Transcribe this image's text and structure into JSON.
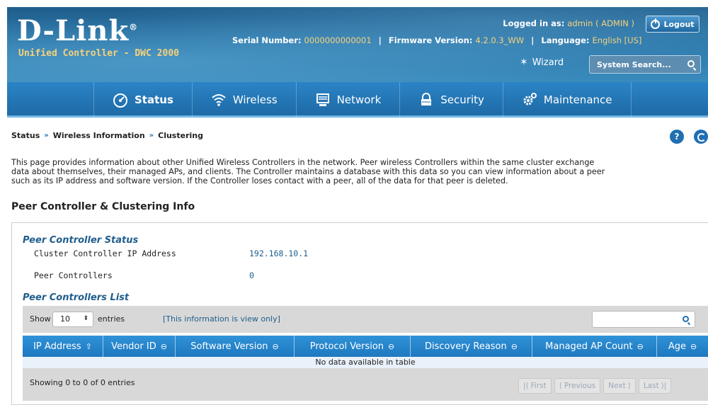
{
  "brand": {
    "logo": "D-Link",
    "logo_mark": "®",
    "product": "Unified Controller - DWC 2000"
  },
  "header": {
    "logged_in_label": "Logged in as:",
    "logged_in_value": "admin ( ADMIN )",
    "logout_label": "Logout",
    "serial_label": "Serial Number:",
    "serial_value": "0000000000001",
    "firmware_label": "Firmware Version:",
    "firmware_value": "4.2.0.3_WW",
    "language_label": "Language:",
    "language_value": "English [US]",
    "separator": "|",
    "wizard_label": "Wizard",
    "search_placeholder": "System Search..."
  },
  "nav": {
    "items": [
      {
        "label": "Status",
        "icon": "gauge-icon"
      },
      {
        "label": "Wireless",
        "icon": "wifi-icon"
      },
      {
        "label": "Network",
        "icon": "monitor-icon"
      },
      {
        "label": "Security",
        "icon": "lock-icon"
      },
      {
        "label": "Maintenance",
        "icon": "gears-icon"
      }
    ]
  },
  "breadcrumb": [
    "Status",
    "Wireless Information",
    "Clustering"
  ],
  "breadcrumb_sep": "»",
  "help_label": "?",
  "description": [
    "This page provides information about other Unified Wireless Controllers in the network. Peer wireless Controllers within the same cluster exchange",
    "data about themselves, their managed APs, and clients. The Controller maintains a database with this data so you can view information about a peer",
    "such as its IP address and software version. If the Controller loses contact with a peer, all of the data for that peer is deleted."
  ],
  "section_title": "Peer Controller & Clustering Info",
  "status": {
    "title": "Peer Controller Status",
    "cluster_ip_label": "Cluster Controller IP Address",
    "cluster_ip_value": "192.168.10.1",
    "peer_count_label": "Peer Controllers",
    "peer_count_value": "0"
  },
  "list": {
    "title": "Peer Controllers List",
    "show_label": "Show",
    "entries_value": "10",
    "entries_label": "entries",
    "view_only": "[This information is view only]",
    "columns": [
      "IP Address",
      "Vendor ID",
      "Software Version",
      "Protocol Version",
      "Discovery Reason",
      "Managed AP Count",
      "Age"
    ],
    "empty_message": "No data available in table",
    "showing": "Showing 0 to 0 of 0 entries",
    "pager": [
      "First",
      "Previous",
      "Next",
      "Last"
    ]
  },
  "colors": {
    "header": "#2a76a8",
    "nav": "#1e6aa6",
    "accent": "#1f6fb2",
    "highlight": "#f6d27a"
  }
}
